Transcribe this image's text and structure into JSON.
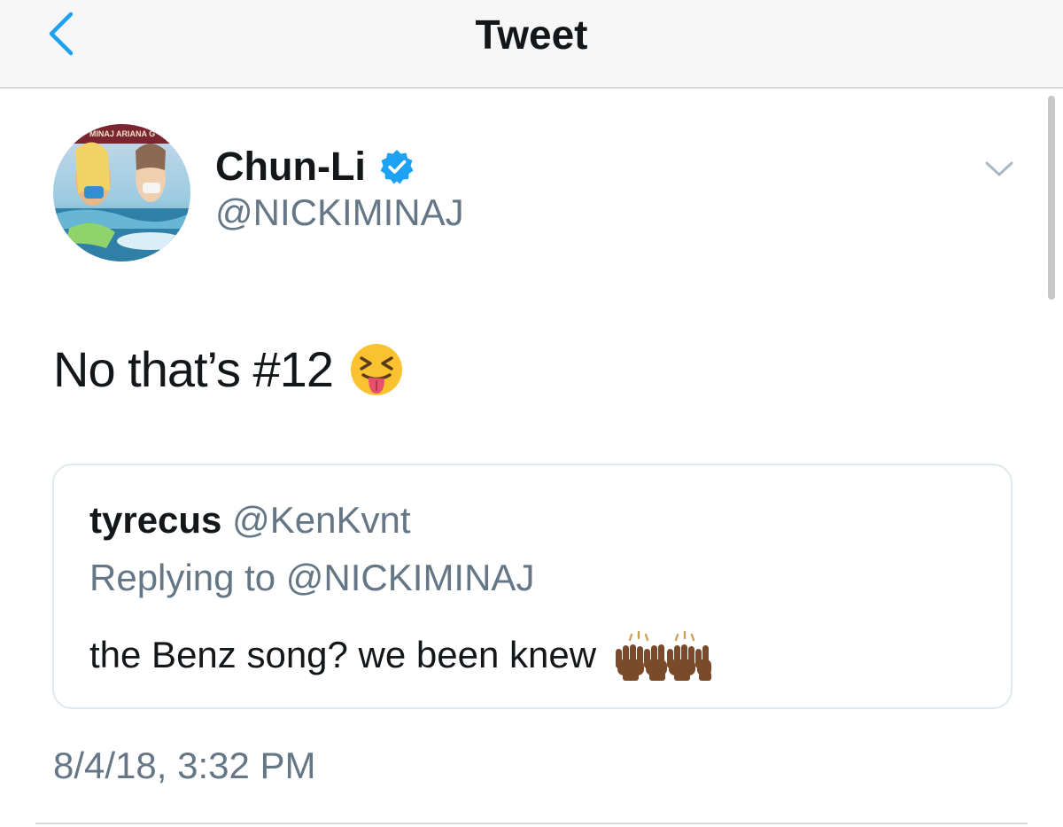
{
  "nav": {
    "title": "Tweet"
  },
  "tweet": {
    "display_name": "Chun-Li",
    "handle": "@NICKIMINAJ",
    "avatar_banner_text": "MINAJ ARIANA G",
    "text": "No that’s #12",
    "emoji": "squinting-face-with-tongue",
    "timestamp": "8/4/18, 3:32 PM"
  },
  "quoted_tweet": {
    "display_name": "tyrecus",
    "handle": "@KenKvnt",
    "replying_to": "Replying to @NICKIMINAJ",
    "text": "the Benz song? we been knew",
    "emoji": "raising-hands-dark-skin-tone"
  },
  "colors": {
    "accent": "#1da1f2",
    "primary_text": "#14171a",
    "secondary_text": "#657786",
    "border": "#e1e8ed"
  }
}
